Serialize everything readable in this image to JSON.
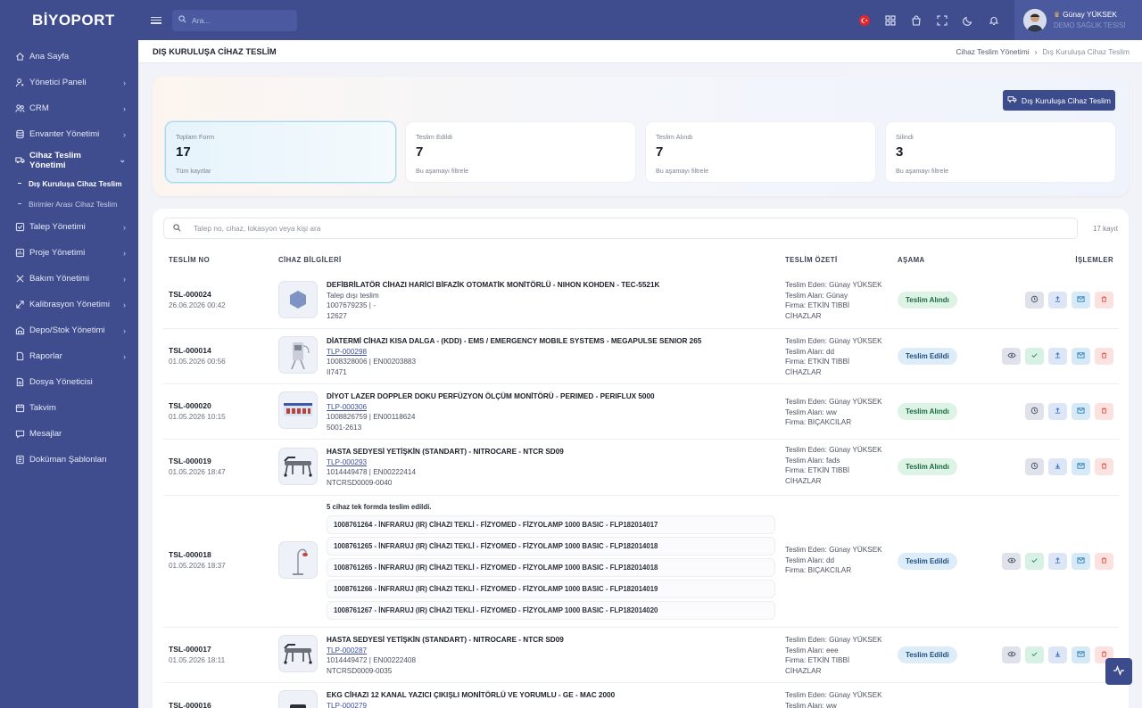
{
  "app": {
    "logo": "BİYOPORT",
    "search_placeholder": "Ara...",
    "flag": "TR"
  },
  "user": {
    "name": "Günay YÜKSEK",
    "org": "DEMO SAĞLIK TESİSİ"
  },
  "sidebar": {
    "items": [
      {
        "label": "Ana Sayfa",
        "icon": "home-icon",
        "chev": ""
      },
      {
        "label": "Yönetici Paneli",
        "icon": "admin-icon",
        "chev": "›"
      },
      {
        "label": "CRM",
        "icon": "users-icon",
        "chev": "›"
      },
      {
        "label": "Envanter Yönetimi",
        "icon": "database-icon",
        "chev": "›"
      },
      {
        "label": "Cihaz Teslim Yönetimi",
        "icon": "truck-icon",
        "chev": "⌄"
      },
      {
        "label": "Talep Yönetimi",
        "icon": "checkbox-icon",
        "chev": "›"
      },
      {
        "label": "Proje Yönetimi",
        "icon": "folder-icon",
        "chev": "›"
      },
      {
        "label": "Bakım Yönetimi",
        "icon": "tools-icon",
        "chev": "›"
      },
      {
        "label": "Kalibrasyon Yönetimi",
        "icon": "calibration-icon",
        "chev": "›"
      },
      {
        "label": "Depo/Stok Yönetimi",
        "icon": "warehouse-icon",
        "chev": "›"
      },
      {
        "label": "Raporlar",
        "icon": "report-icon",
        "chev": "›"
      },
      {
        "label": "Dosya Yöneticisi",
        "icon": "file-icon",
        "chev": ""
      },
      {
        "label": "Takvim",
        "icon": "calendar-icon",
        "chev": ""
      },
      {
        "label": "Mesajlar",
        "icon": "message-icon",
        "chev": ""
      },
      {
        "label": "Doküman Şablonları",
        "icon": "document-icon",
        "chev": ""
      }
    ],
    "sub": [
      "Dış Kuruluşa Cihaz Teslim",
      "Birimler Arası Cihaz Teslim"
    ]
  },
  "page": {
    "title": "DIŞ KURULUŞA CİHAZ TESLİM",
    "crumb_parent": "Cihaz Teslim Yönetimi",
    "crumb_sep": "›",
    "crumb_current": "Dış Kuruluşa Cihaz Teslim",
    "new_button": "Dış Kuruluşa Cihaz Teslim"
  },
  "cards": [
    {
      "label": "Toplam Form",
      "value": "17",
      "sub": "Tüm kayıtlar"
    },
    {
      "label": "Teslim Edildi",
      "value": "7",
      "sub": "Bu aşamayı filtrele"
    },
    {
      "label": "Teslim Alındı",
      "value": "7",
      "sub": "Bu aşamayı filtrele"
    },
    {
      "label": "Silindi",
      "value": "3",
      "sub": "Bu aşamayı filtrele"
    }
  ],
  "table": {
    "search_placeholder": "Talep no, cihaz, lokasyon veya kişi ara",
    "count": "17 kayıt",
    "headers": [
      "TESLİM NO",
      "CİHAZ BİLGİLERİ",
      "TESLİM ÖZETİ",
      "AŞAMA",
      "İŞLEMLER"
    ],
    "rows": [
      {
        "no": "TSL-000024",
        "date": "26.06.2026 00:42",
        "name": "DEFİBRİLATÖR CİHAZI HARİCİ BİFAZİK OTOMATİK MONİTÖRLÜ - NIHON KOHDEN - TEC-5521K",
        "tlp": "Talep dışı teslim",
        "l2": "1007679235 | -",
        "l3": "12627",
        "s1": "Teslim Eden: Günay YÜKSEK",
        "s2": "Teslim Alan: Günay",
        "s3": "Firma: ETKİN TIBBİ",
        "s4": "CİHAZLAR",
        "stage": "Teslim Alındı"
      },
      {
        "no": "TSL-000014",
        "date": "01.05.2026 00:56",
        "name": "DİATERMİ CİHAZI KISA DALGA - (KDD) - EMS / EMERGENCY MOBILE SYSTEMS - MEGAPULSE SENIOR 265",
        "tlp": "TLP-000298",
        "l2": "1008328006 | EN00203883",
        "l3": "II7471",
        "s1": "Teslim Eden: Günay YÜKSEK",
        "s2": "Teslim Alan: dd",
        "s3": "Firma: ETKİN TIBBİ",
        "s4": "CİHAZLAR",
        "stage": "Teslim Edildi"
      },
      {
        "no": "TSL-000020",
        "date": "01.05.2026 10:15",
        "name": "DİYOT LAZER DOPPLER DOKU PERFÜZYON ÖLÇÜM MONİTÖRÜ - PERIMED - PERIFLUX 5000",
        "tlp": "TLP-000306",
        "l2": "1008826759 | EN00118624",
        "l3": "5001-2613",
        "s1": "Teslim Eden: Günay YÜKSEK",
        "s2": "Teslim Alan: ww",
        "s3": "Firma: BIÇAKCILAR",
        "s4": "",
        "stage": "Teslim Alındı"
      },
      {
        "no": "TSL-000019",
        "date": "01.05.2026 18:47",
        "name": "HASTA SEDYESİ YETİŞKİN (STANDART) - NITROCARE - NTCR SD09",
        "tlp": "TLP-000293",
        "l2": "1014449478 | EN00222414",
        "l3": "NTCRSD0009-0040",
        "s1": "Teslim Eden: Günay YÜKSEK",
        "s2": "Teslim Alan: fads",
        "s3": "Firma: ETKİN TIBBİ",
        "s4": "CİHAZLAR",
        "stage": "Teslim Alındı"
      },
      {
        "no": "TSL-000018",
        "date": "01.05.2026 18:37",
        "note": "5 cihaz tek formda teslim edildi.",
        "devices": [
          "1008761264 - İNFRARUJ (IR) CİHAZI TEKLİ - FİZYOMED - FİZYOLAMP 1000 BASIC - FLP182014017",
          "1008761265 - İNFRARUJ (IR) CİHAZI TEKLİ - FİZYOMED - FİZYOLAMP 1000 BASIC - FLP182014018",
          "1008761265 - İNFRARUJ (IR) CİHAZI TEKLİ - FİZYOMED - FİZYOLAMP 1000 BASIC - FLP182014018",
          "1008761266 - İNFRARUJ (IR) CİHAZI TEKLİ - FİZYOMED - FİZYOLAMP 1000 BASIC - FLP182014019",
          "1008761267 - İNFRARUJ (IR) CİHAZI TEKLİ - FİZYOMED - FİZYOLAMP 1000 BASIC - FLP182014020"
        ],
        "s1": "Teslim Eden: Günay YÜKSEK",
        "s2": "Teslim Alan: dd",
        "s3": "Firma: BIÇAKCILAR",
        "s4": "",
        "stage": "Teslim Edildi"
      },
      {
        "no": "TSL-000017",
        "date": "01.05.2026 18:11",
        "name": "HASTA SEDYESİ YETİŞKİN (STANDART) - NITROCARE - NTCR SD09",
        "tlp": "TLP-000287",
        "l2": "1014449472 | EN00222408",
        "l3": "NTCRSD0009-0035",
        "s1": "Teslim Eden: Günay YÜKSEK",
        "s2": "Teslim Alan: eee",
        "s3": "Firma: ETKİN TIBBİ",
        "s4": "CİHAZLAR",
        "stage": "Teslim Edildi"
      },
      {
        "no": "TSL-000016",
        "date": "",
        "name": "EKG CİHAZI 12 KANAL YAZICI ÇIKIŞLI MONİTÖRLÜ VE YORUMLU - GE - MAC 2000",
        "tlp": "TLP-000279",
        "l2": "",
        "l3": "",
        "s1": "Teslim Eden: Günay YÜKSEK",
        "s2": "Teslim Alan: ww",
        "s3": "",
        "s4": "",
        "stage": ""
      }
    ]
  },
  "colors": {
    "sidebar": "#3f4d8f",
    "accent": "#3c4b8c",
    "received": "#ddf3e6",
    "delivered": "#dcecf8",
    "delete": "#fbe1df"
  }
}
